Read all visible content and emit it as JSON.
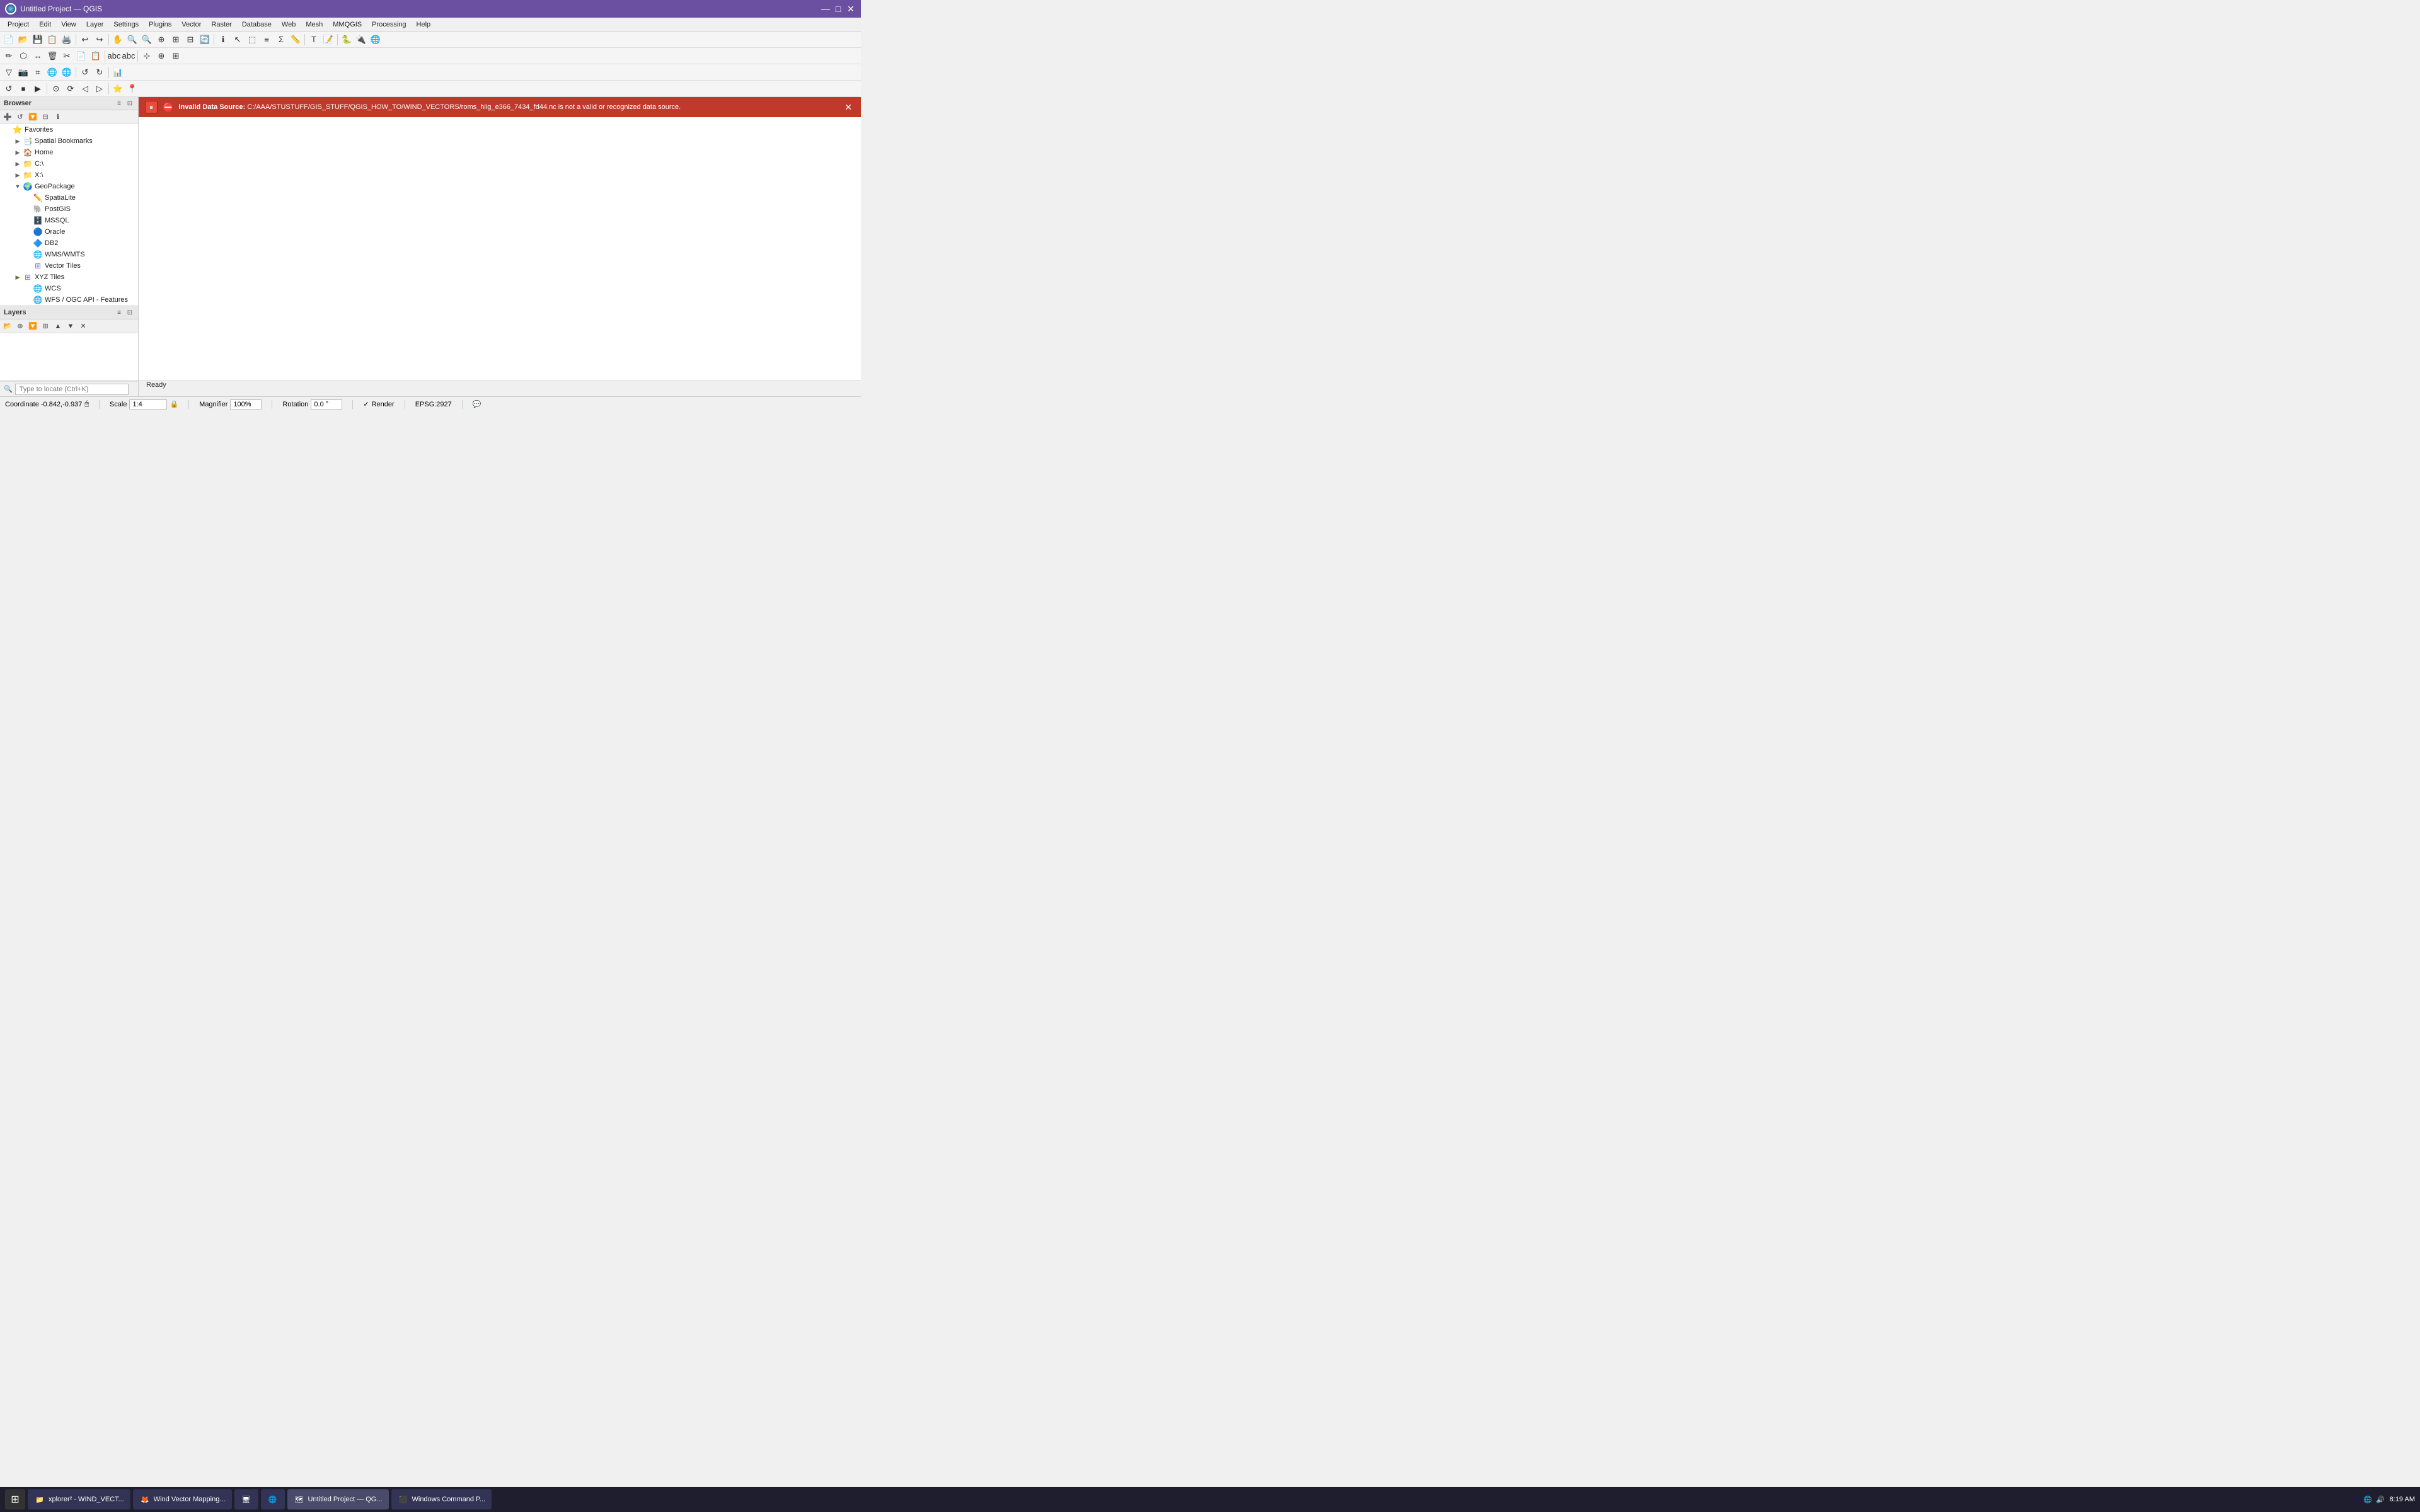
{
  "titleBar": {
    "title": "Untitled Project — QGIS",
    "minimize": "—",
    "maximize": "□",
    "close": "✕"
  },
  "menuBar": {
    "items": [
      "Project",
      "Edit",
      "View",
      "Layer",
      "Settings",
      "Plugins",
      "Vector",
      "Raster",
      "Database",
      "Web",
      "Mesh",
      "MMQGIS",
      "Processing",
      "Help"
    ]
  },
  "errorBanner": {
    "label": "Invalid Data Source:",
    "message": " C:/AAA/STUSTUFF/GIS_STUFF/QGIS_HOW_TO/WIND_VECTORS/roms_hiig_e366_7434_fd44.nc is not a valid or recognized data source."
  },
  "browser": {
    "title": "Browser",
    "items": [
      {
        "id": "favorites",
        "label": "Favorites",
        "icon": "⭐",
        "indent": 0,
        "hasArrow": false,
        "arrowDir": "▶"
      },
      {
        "id": "spatial-bookmarks",
        "label": "Spatial Bookmarks",
        "icon": "📑",
        "indent": 1,
        "hasArrow": true,
        "arrowDir": "▶"
      },
      {
        "id": "home",
        "label": "Home",
        "icon": "🏠",
        "indent": 1,
        "hasArrow": true,
        "arrowDir": "▶"
      },
      {
        "id": "c-drive",
        "label": "C:\\",
        "icon": "📁",
        "indent": 1,
        "hasArrow": true,
        "arrowDir": "▶"
      },
      {
        "id": "x-drive",
        "label": "X:\\",
        "icon": "📁",
        "indent": 1,
        "hasArrow": true,
        "arrowDir": "▶"
      },
      {
        "id": "geopackage",
        "label": "GeoPackage",
        "icon": "🌍",
        "indent": 1,
        "hasArrow": true,
        "arrowDir": "▼"
      },
      {
        "id": "spatialite",
        "label": "SpatiaLite",
        "icon": "✏️",
        "indent": 2,
        "hasArrow": false,
        "arrowDir": ""
      },
      {
        "id": "postgis",
        "label": "PostGIS",
        "icon": "🐘",
        "indent": 2,
        "hasArrow": false,
        "arrowDir": ""
      },
      {
        "id": "mssql",
        "label": "MSSQL",
        "icon": "🗄️",
        "indent": 2,
        "hasArrow": false,
        "arrowDir": ""
      },
      {
        "id": "oracle",
        "label": "Oracle",
        "icon": "🔵",
        "indent": 2,
        "hasArrow": false,
        "arrowDir": ""
      },
      {
        "id": "db2",
        "label": "DB2",
        "icon": "🔷",
        "indent": 2,
        "hasArrow": false,
        "arrowDir": ""
      },
      {
        "id": "wms-wmts",
        "label": "WMS/WMTS",
        "icon": "🌐",
        "indent": 2,
        "hasArrow": false,
        "arrowDir": ""
      },
      {
        "id": "vector-tiles",
        "label": "Vector Tiles",
        "icon": "⊞",
        "indent": 2,
        "hasArrow": false,
        "arrowDir": ""
      },
      {
        "id": "xyz-tiles",
        "label": "XYZ Tiles",
        "icon": "⊞",
        "indent": 1,
        "hasArrow": true,
        "arrowDir": "▶"
      },
      {
        "id": "wcs",
        "label": "WCS",
        "icon": "🌐",
        "indent": 2,
        "hasArrow": false,
        "arrowDir": ""
      },
      {
        "id": "wfs-ogc",
        "label": "WFS / OGC API - Features",
        "icon": "🌐",
        "indent": 2,
        "hasArrow": false,
        "arrowDir": ""
      }
    ]
  },
  "layers": {
    "title": "Layers"
  },
  "statusBar": {
    "coordinate": "Coordinate -0.842,-0.937",
    "scale_label": "Scale",
    "scale_value": "1:4",
    "magnifier_label": "Magnifier",
    "magnifier_value": "100%",
    "rotation_label": "Rotation",
    "rotation_value": "0.0 °",
    "render_label": "Render",
    "epsg": "EPSG:2927"
  },
  "searchBar": {
    "placeholder": "Type to locate (Ctrl+K)",
    "ready": "Ready"
  },
  "taskbar": {
    "items": [
      {
        "id": "start",
        "label": "⊞",
        "isStart": true
      },
      {
        "id": "xplorer",
        "label": "xplorer² - WIND_VECT..."
      },
      {
        "id": "wind-vector",
        "label": "Wind Vector Mapping..."
      },
      {
        "id": "cmd",
        "label": ""
      },
      {
        "id": "browser-app",
        "label": ""
      },
      {
        "id": "qgis-main",
        "label": "Untitled Project — QG..."
      },
      {
        "id": "cmd-window",
        "label": "Windows Command P..."
      }
    ],
    "clock": "8:19 AM"
  }
}
